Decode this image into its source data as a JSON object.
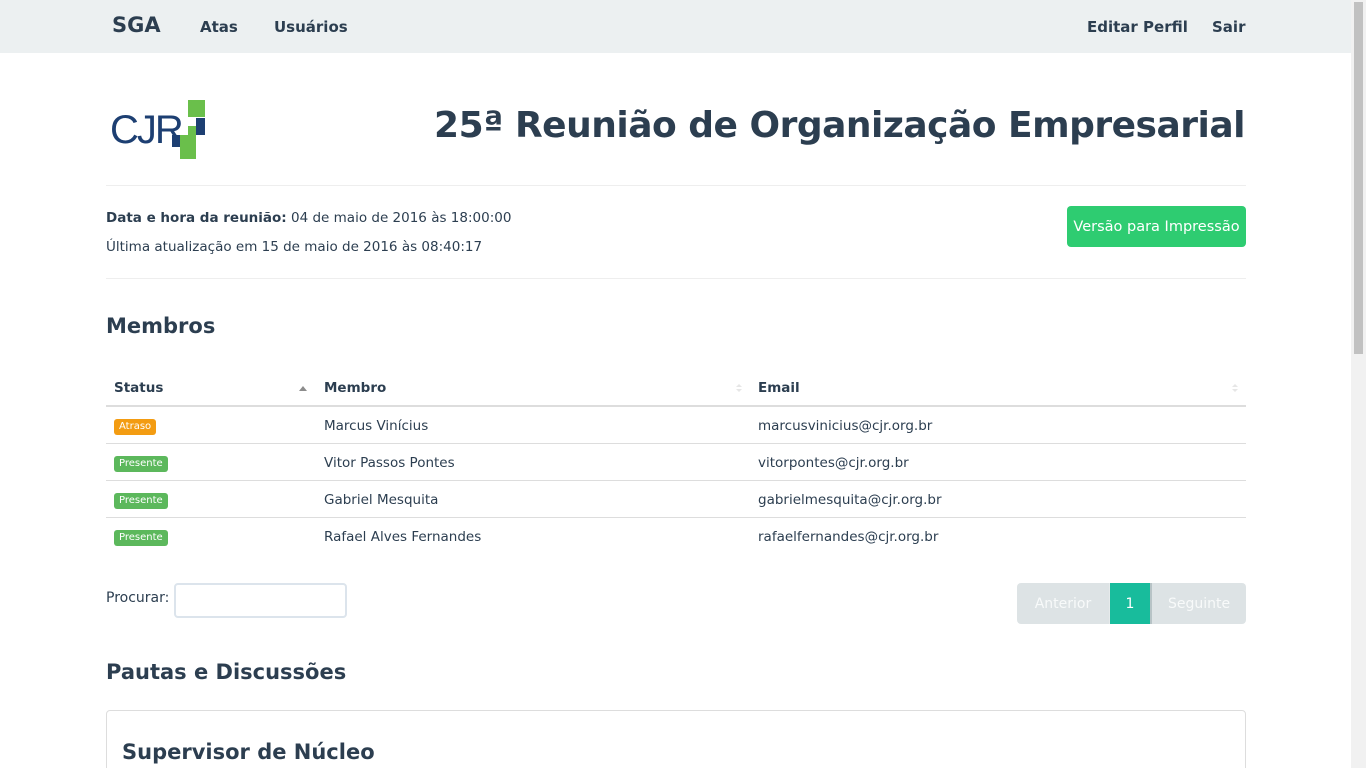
{
  "navbar": {
    "brand": "SGA",
    "links": {
      "atas": "Atas",
      "usuarios": "Usuários"
    },
    "right_links": {
      "editar_perfil": "Editar Perfil",
      "sair": "Sair"
    }
  },
  "header": {
    "logo_text": "CJR",
    "title": "25ª Reunião de Organização Empresarial"
  },
  "meeting": {
    "datetime_label": "Data e hora da reunião:",
    "datetime_value": "04 de maio de 2016 às 18:00:00",
    "last_update": "Última atualização em 15 de maio de 2016 às 08:40:17",
    "print_button": "Versão para Impressão"
  },
  "members": {
    "section_title": "Membros",
    "columns": {
      "status": "Status",
      "member": "Membro",
      "email": "Email"
    },
    "rows": [
      {
        "status": "Atraso",
        "status_color": "#f39c12",
        "name": "Marcus Vinícius",
        "email": "marcusvinicius@cjr.org.br"
      },
      {
        "status": "Presente",
        "status_color": "#5cb85c",
        "name": "Vitor Passos Pontes",
        "email": "vitorpontes@cjr.org.br"
      },
      {
        "status": "Presente",
        "status_color": "#5cb85c",
        "name": "Gabriel Mesquita",
        "email": "gabrielmesquita@cjr.org.br"
      },
      {
        "status": "Presente",
        "status_color": "#5cb85c",
        "name": "Rafael Alves Fernandes",
        "email": "rafaelfernandes@cjr.org.br"
      }
    ],
    "search_label": "Procurar:",
    "search_value": "",
    "pagination": {
      "previous": "Anterior",
      "current_page": "1",
      "next": "Seguinte"
    }
  },
  "agenda": {
    "section_title": "Pautas e Discussões",
    "first_item_title": "Supervisor de Núcleo"
  },
  "colors": {
    "primary": "#2c3e50",
    "success": "#2ecc71",
    "accent": "#18bc9c",
    "logo_blue": "#1d3f72",
    "logo_green": "#6abf4b"
  }
}
